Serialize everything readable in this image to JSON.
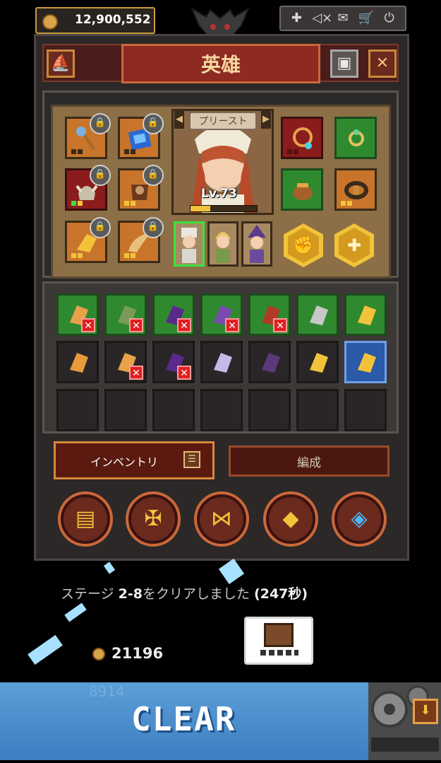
{
  "currency": {
    "gold": "12,900,552"
  },
  "system_menu": {
    "icons": [
      "add-icon",
      "mute-icon",
      "mail-icon",
      "cart-icon",
      "power-icon"
    ],
    "glyphs": [
      "✚",
      "◁×",
      "✉",
      "🛒",
      "⏻"
    ]
  },
  "header": {
    "title": "英雄",
    "back_glyph": "⛵",
    "frame_glyph": "▣",
    "close_glyph": "✕"
  },
  "hero": {
    "class_label": "プリースト",
    "level_text": "Lv.73",
    "xp_fraction": 0.3,
    "prev_glyph": "◀",
    "next_glyph": "▶"
  },
  "equipment": {
    "lock_glyph": "🔒"
  },
  "inventory": {
    "remove_glyph": "✕"
  },
  "tabs": {
    "inventory": "インベントリ",
    "formation": "編成",
    "menu_glyph": "☰"
  },
  "action_buttons": [
    {
      "icon": "chest-icon",
      "glyph": "▤"
    },
    {
      "icon": "cross-icon",
      "glyph": "✠"
    },
    {
      "icon": "emblem-icon",
      "glyph": "⋈"
    },
    {
      "icon": "box-icon",
      "glyph": "◆"
    },
    {
      "icon": "crystal-icon",
      "glyph": "◈"
    }
  ],
  "stage": {
    "prefix": "ステージ ",
    "stage": "2-8",
    "middle": "をクリアしました ",
    "time": "(247秒)"
  },
  "reward": {
    "gold": "21196"
  },
  "banner": {
    "text": "CLEAR",
    "ghost": "8914"
  },
  "colors": {
    "accent_gold": "#f2c33a",
    "frame_orange": "#c98a3a",
    "title_red": "#8e2a22",
    "clear_blue": "#4a8ed0"
  }
}
